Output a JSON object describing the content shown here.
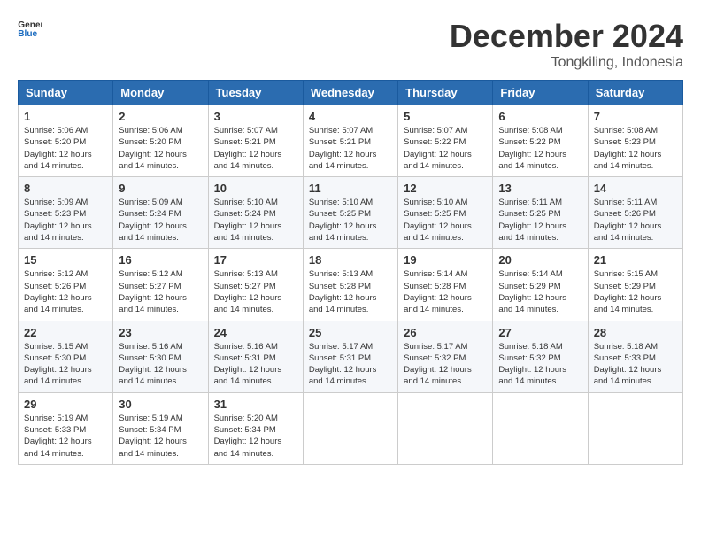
{
  "logo": {
    "text_general": "General",
    "text_blue": "Blue"
  },
  "header": {
    "month": "December 2024",
    "location": "Tongkiling, Indonesia"
  },
  "weekdays": [
    "Sunday",
    "Monday",
    "Tuesday",
    "Wednesday",
    "Thursday",
    "Friday",
    "Saturday"
  ],
  "weeks": [
    [
      {
        "day": "1",
        "sunrise": "5:06 AM",
        "sunset": "5:20 PM",
        "daylight": "12 hours and 14 minutes."
      },
      {
        "day": "2",
        "sunrise": "5:06 AM",
        "sunset": "5:20 PM",
        "daylight": "12 hours and 14 minutes."
      },
      {
        "day": "3",
        "sunrise": "5:07 AM",
        "sunset": "5:21 PM",
        "daylight": "12 hours and 14 minutes."
      },
      {
        "day": "4",
        "sunrise": "5:07 AM",
        "sunset": "5:21 PM",
        "daylight": "12 hours and 14 minutes."
      },
      {
        "day": "5",
        "sunrise": "5:07 AM",
        "sunset": "5:22 PM",
        "daylight": "12 hours and 14 minutes."
      },
      {
        "day": "6",
        "sunrise": "5:08 AM",
        "sunset": "5:22 PM",
        "daylight": "12 hours and 14 minutes."
      },
      {
        "day": "7",
        "sunrise": "5:08 AM",
        "sunset": "5:23 PM",
        "daylight": "12 hours and 14 minutes."
      }
    ],
    [
      {
        "day": "8",
        "sunrise": "5:09 AM",
        "sunset": "5:23 PM",
        "daylight": "12 hours and 14 minutes."
      },
      {
        "day": "9",
        "sunrise": "5:09 AM",
        "sunset": "5:24 PM",
        "daylight": "12 hours and 14 minutes."
      },
      {
        "day": "10",
        "sunrise": "5:10 AM",
        "sunset": "5:24 PM",
        "daylight": "12 hours and 14 minutes."
      },
      {
        "day": "11",
        "sunrise": "5:10 AM",
        "sunset": "5:25 PM",
        "daylight": "12 hours and 14 minutes."
      },
      {
        "day": "12",
        "sunrise": "5:10 AM",
        "sunset": "5:25 PM",
        "daylight": "12 hours and 14 minutes."
      },
      {
        "day": "13",
        "sunrise": "5:11 AM",
        "sunset": "5:25 PM",
        "daylight": "12 hours and 14 minutes."
      },
      {
        "day": "14",
        "sunrise": "5:11 AM",
        "sunset": "5:26 PM",
        "daylight": "12 hours and 14 minutes."
      }
    ],
    [
      {
        "day": "15",
        "sunrise": "5:12 AM",
        "sunset": "5:26 PM",
        "daylight": "12 hours and 14 minutes."
      },
      {
        "day": "16",
        "sunrise": "5:12 AM",
        "sunset": "5:27 PM",
        "daylight": "12 hours and 14 minutes."
      },
      {
        "day": "17",
        "sunrise": "5:13 AM",
        "sunset": "5:27 PM",
        "daylight": "12 hours and 14 minutes."
      },
      {
        "day": "18",
        "sunrise": "5:13 AM",
        "sunset": "5:28 PM",
        "daylight": "12 hours and 14 minutes."
      },
      {
        "day": "19",
        "sunrise": "5:14 AM",
        "sunset": "5:28 PM",
        "daylight": "12 hours and 14 minutes."
      },
      {
        "day": "20",
        "sunrise": "5:14 AM",
        "sunset": "5:29 PM",
        "daylight": "12 hours and 14 minutes."
      },
      {
        "day": "21",
        "sunrise": "5:15 AM",
        "sunset": "5:29 PM",
        "daylight": "12 hours and 14 minutes."
      }
    ],
    [
      {
        "day": "22",
        "sunrise": "5:15 AM",
        "sunset": "5:30 PM",
        "daylight": "12 hours and 14 minutes."
      },
      {
        "day": "23",
        "sunrise": "5:16 AM",
        "sunset": "5:30 PM",
        "daylight": "12 hours and 14 minutes."
      },
      {
        "day": "24",
        "sunrise": "5:16 AM",
        "sunset": "5:31 PM",
        "daylight": "12 hours and 14 minutes."
      },
      {
        "day": "25",
        "sunrise": "5:17 AM",
        "sunset": "5:31 PM",
        "daylight": "12 hours and 14 minutes."
      },
      {
        "day": "26",
        "sunrise": "5:17 AM",
        "sunset": "5:32 PM",
        "daylight": "12 hours and 14 minutes."
      },
      {
        "day": "27",
        "sunrise": "5:18 AM",
        "sunset": "5:32 PM",
        "daylight": "12 hours and 14 minutes."
      },
      {
        "day": "28",
        "sunrise": "5:18 AM",
        "sunset": "5:33 PM",
        "daylight": "12 hours and 14 minutes."
      }
    ],
    [
      {
        "day": "29",
        "sunrise": "5:19 AM",
        "sunset": "5:33 PM",
        "daylight": "12 hours and 14 minutes."
      },
      {
        "day": "30",
        "sunrise": "5:19 AM",
        "sunset": "5:34 PM",
        "daylight": "12 hours and 14 minutes."
      },
      {
        "day": "31",
        "sunrise": "5:20 AM",
        "sunset": "5:34 PM",
        "daylight": "12 hours and 14 minutes."
      },
      null,
      null,
      null,
      null
    ]
  ],
  "labels": {
    "sunrise": "Sunrise:",
    "sunset": "Sunset:",
    "daylight": "Daylight:"
  }
}
